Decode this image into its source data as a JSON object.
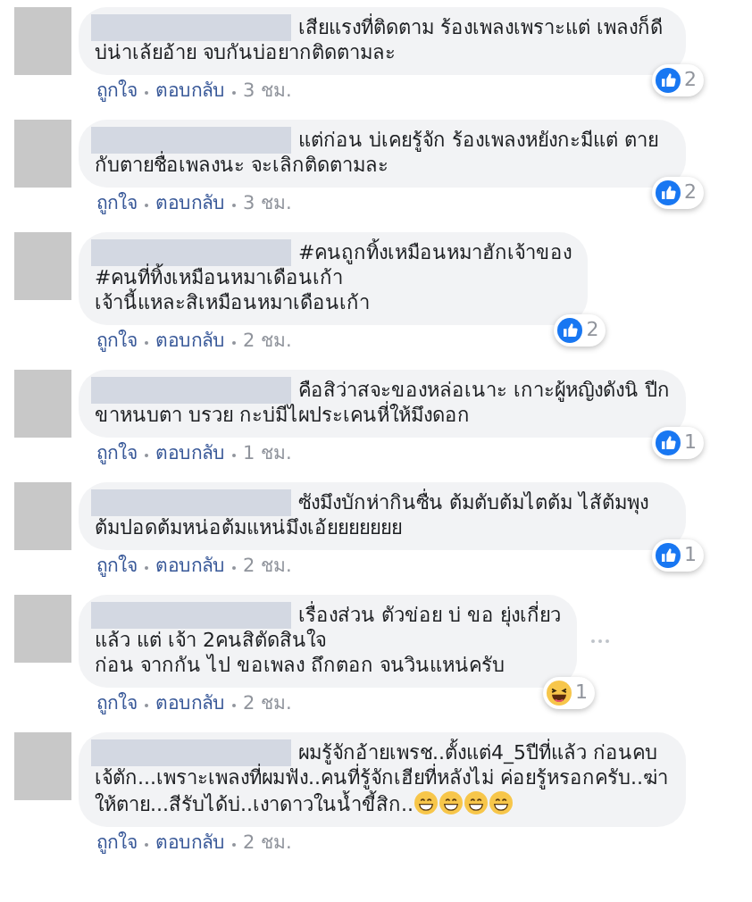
{
  "comments": [
    {
      "text": "เสียแรงที่ติดตาม ร้องเพลงเพราะแต่ เพลงก็ดี บ่น่าเล้ยอ้าย จบกันบ่อยากติดตามละ",
      "reaction": {
        "kind": "like",
        "count": "2"
      },
      "show_options": false,
      "actions": [
        "ถูกใจ",
        "ตอบกลับ"
      ],
      "time": "3 ชม."
    },
    {
      "text": "แต่ก่อน บ่เคยรู้จัก ร้องเพลงหยังกะมีแต่ ตายกับตายชื่อเพลงนะ จะเลิกติดตามละ",
      "reaction": {
        "kind": "like",
        "count": "2"
      },
      "show_options": false,
      "actions": [
        "ถูกใจ",
        "ตอบกลับ"
      ],
      "time": "3 ชม."
    },
    {
      "text": "#คนถูกทิ้งเหมือนหมาฮักเจ้าของ\n#คนที่ทิ้งเหมือนหมาเดือนเก้า\nเจ้านี้แหละสิเหมือนหมาเดือนเก้า",
      "reaction": {
        "kind": "like",
        "count": "2"
      },
      "show_options": false,
      "actions": [
        "ถูกใจ",
        "ตอบกลับ"
      ],
      "time": "2 ชม."
    },
    {
      "text": "คือสิว่าสจะของหล่อเนาะ เกาะผู้หญิงดังนิ ปีกขาหนบตา บรวย กะบ่มีไผประเคนหี่ให้มึงดอก",
      "reaction": {
        "kind": "like",
        "count": "1"
      },
      "show_options": false,
      "actions": [
        "ถูกใจ",
        "ตอบกลับ"
      ],
      "time": "1 ชม."
    },
    {
      "text": "ซังมึงบักห่ากินซื่น ต้มตับต้มไตต้ม ไส้ต้มพุง ต้มปอดต้มหน่อต้มแหน่มึงเอ้ยยยยยยย",
      "reaction": {
        "kind": "like",
        "count": "1"
      },
      "show_options": false,
      "actions": [
        "ถูกใจ",
        "ตอบกลับ"
      ],
      "time": "2 ชม."
    },
    {
      "text": "เรื่องส่วน ตัวข่อย บ่ ขอ ยุ่งเกี่ยว\nแล้ว แต่ เจ้า 2คนสิตัดสินใจ\nก่อน จากกัน ไป ขอเพลง ถึกตอก จนวินแหน่ครับ",
      "reaction": {
        "kind": "haha",
        "count": "1"
      },
      "show_options": true,
      "actions": [
        "ถูกใจ",
        "ตอบกลับ"
      ],
      "time": "2 ชม."
    },
    {
      "text": "ผมรู้จักอ้ายเพรช..ตั้งแต่4_5ปีที่แล้ว ก่อนคบเจ้ตัก...เพราะเพลงที่ผมฟัง..คนที่รู้จักเฮียที่หลังไม่ ค่อยรู้หรอกครับ..ฆ่าให้ตาย...สีรับได้บ่..เงาดาวในน้ำขี้สิก..",
      "trailing_emoji": [
        {
          "kind": "grin"
        },
        {
          "kind": "grin"
        },
        {
          "kind": "grin"
        },
        {
          "kind": "grin"
        }
      ],
      "show_options": false,
      "actions": [
        "ถูกใจ",
        "ตอบกลับ"
      ],
      "time": "2 ชม."
    }
  ]
}
